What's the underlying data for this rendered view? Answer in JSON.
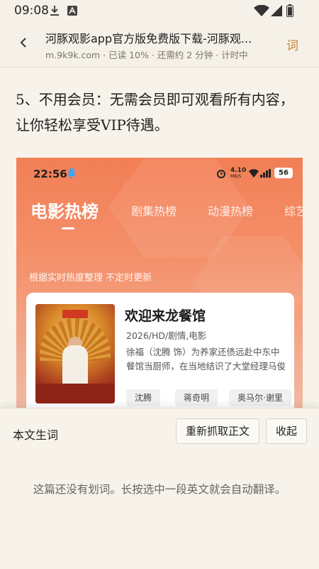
{
  "status_bar": {
    "time": "09:08"
  },
  "header": {
    "title": "河豚观影app官方版免费版下载-河豚观...",
    "meta": "m.9k9k.com · 已读 10% · 还需约 2 分钟 · 计时中",
    "word_button": "词"
  },
  "article": {
    "paragraph": "5、不用会员：无需会员即可观看所有内容，让你轻松享受VIP待遇。"
  },
  "screenshot": {
    "time": "22:56",
    "net_speed": "4.10",
    "net_unit": "MB/S",
    "battery": "56",
    "tabs": [
      "电影热榜",
      "剧集热榜",
      "动漫热榜",
      "综艺"
    ],
    "note": "根据实时热度整理 不定时更新",
    "card": {
      "title": "欢迎来龙餐馆",
      "sub": "2026/HD/剧情,电影",
      "desc": "徐福（沈腾 饰）为养家还债远赴中东中餐馆当厨师，在当地结识了大堂经理马俊生（蒋奇明 饰）。他…",
      "chips": [
        "沈腾",
        "蒋奇明",
        "奥马尔·谢里"
      ]
    }
  },
  "panel": {
    "title": "本文生词",
    "refetch_button": "重新抓取正文",
    "collapse_button": "收起",
    "empty_text": "这篇还没有划词。长按选中一段英文就会自动翻译。"
  },
  "colors": {
    "accent": "#c3812d",
    "banner": "#f27f55"
  }
}
